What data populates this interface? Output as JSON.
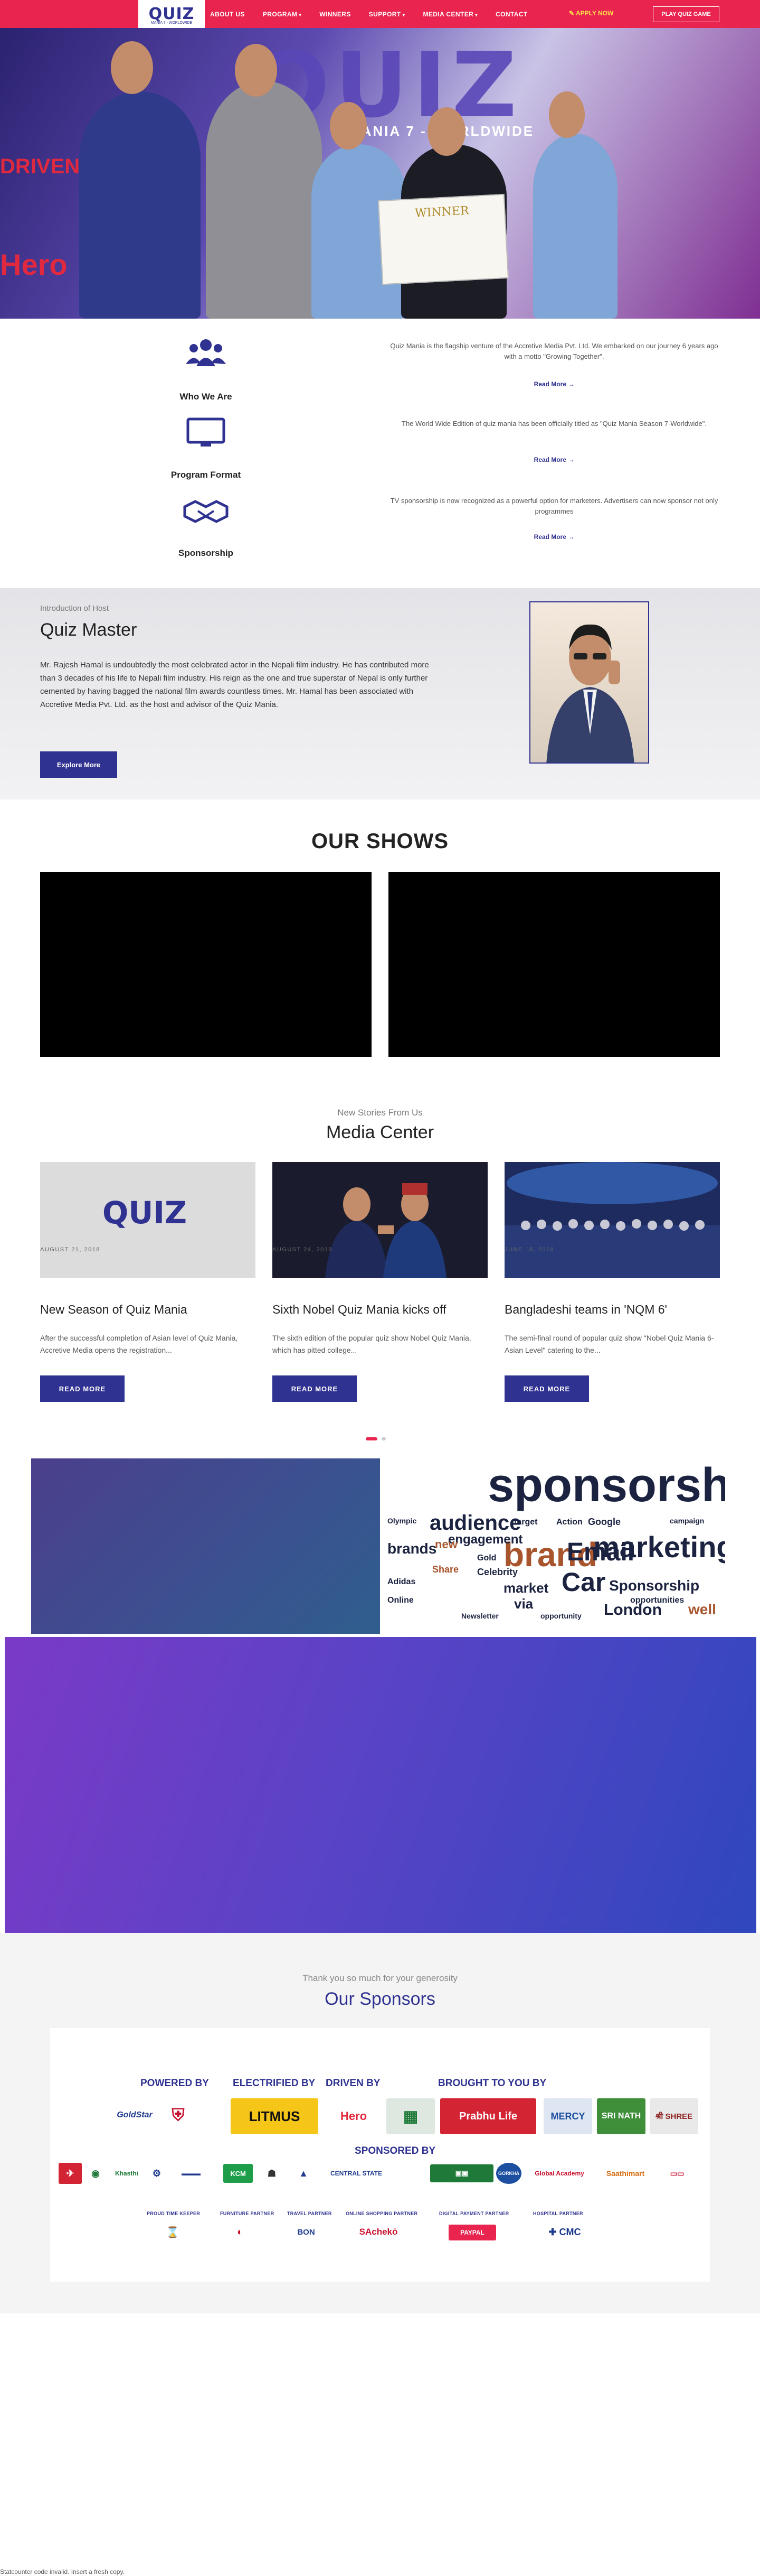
{
  "header": {
    "logo_text": "QUIZ",
    "logo_sub": "MANIA 7 - WORLDWIDE",
    "nav": [
      {
        "label": "ABOUT US",
        "caret": false
      },
      {
        "label": "PROGRAM",
        "caret": true
      },
      {
        "label": "WINNERS",
        "caret": false
      },
      {
        "label": "SUPPORT",
        "caret": true
      },
      {
        "label": "MEDIA CENTER",
        "caret": true
      },
      {
        "label": "CONTACT",
        "caret": false
      }
    ],
    "apply_label": "APPLY NOW",
    "play_label": "PLAY QUIZ GAME",
    "colors": {
      "bar": "#e8244f",
      "accent": "#2f3290"
    }
  },
  "hero": {
    "banner_text": "QUIZ",
    "banner_sub": "MANIA 7 - WORLDWIDE",
    "left_text_1": "DRIVEN",
    "left_text_2": "Hero",
    "cheque_text": "WINNER"
  },
  "services": [
    {
      "icon": "users-icon",
      "label": "Who We Are",
      "text": "Quiz Mania is the flagship venture of the Accretive Media Pvt. Ltd. We embarked on our journey 6 years ago with a motto \"Growing Together\".",
      "more": "Read More →"
    },
    {
      "icon": "monitor-icon",
      "label": "Program Format",
      "text": "The World Wide Edition of quiz mania has been officially titled as \"Quiz Mania Season 7-Worldwide\".",
      "more": "Read More →"
    },
    {
      "icon": "handshake-icon",
      "label": "Sponsorship",
      "text": "TV sponsorship is now recognized as a powerful option for marketers. Advertisers can now sponsor not only programmes",
      "more": "Read More →"
    }
  ],
  "quiz_master": {
    "pre": "Introduction of Host",
    "title": "Quiz Master",
    "desc": "Mr. Rajesh Hamal is undoubtedly the most celebrated actor in the Nepali film industry. He has contributed more than 3 decades of his life to Nepali film industry. His reign as the one and true superstar of Nepal is only further cemented by having bagged the national film awards countless times. Mr. Hamal has been associated with Accretive Media Pvt. Ltd. as the host and advisor of the Quiz Mania.",
    "button": "Explore More"
  },
  "shows": {
    "title": "OUR SHOWS"
  },
  "media": {
    "pre": "New Stories From Us",
    "title": "Media Center",
    "cards": [
      {
        "date": "AUGUST 21, 2018",
        "title": "New Season of Quiz Mania",
        "desc": "After the successful completion of Asian level of Quiz Mania, Accretive Media opens the registration...",
        "button": "READ MORE"
      },
      {
        "date": "AUGUST 24, 2018",
        "title": "Sixth Nobel Quiz Mania kicks off",
        "desc": "The sixth edition of the popular quiz show Nobel Quiz Mania, which has pitted college...",
        "button": "READ MORE"
      },
      {
        "date": "JUNE 18, 2018",
        "title": "Bangladeshi teams in 'NQM 6'",
        "desc": "The semi-final round of popular quiz show \"Nobel Quiz Mania 6-Asian Level\" catering to the...",
        "button": "READ MORE"
      }
    ]
  },
  "sponsorship_cloud": {
    "words": [
      "sponsorship",
      "audience",
      "brand",
      "Email",
      "marketing",
      "Car",
      "Sponsorship",
      "engagement",
      "London",
      "brands",
      "market",
      "new",
      "via",
      "opportunity",
      "Google",
      "target",
      "Share",
      "Celebrity",
      "opportunities",
      "well",
      "campaign",
      "Adidas",
      "Olympic",
      "Gold",
      "Action",
      "Online",
      "Newsletter"
    ]
  },
  "sponsors": {
    "pre": "Thank you so much for your generosity",
    "title": "Our Sponsors",
    "headings": {
      "powered": "POWERED BY",
      "electrified": "ELECTRIFIED BY",
      "driven": "DRIVEN BY",
      "brought": "BROUGHT TO YOU BY",
      "sponsored": "SPONSORED BY"
    },
    "partner_labels": [
      "PROUD TIME KEEPER",
      "FURNITURE PARTNER",
      "TRAVEL PARTNER",
      "ONLINE SHOPPING PARTNER",
      "DIGITAL PAYMENT PARTNER",
      "HOSPITAL PARTNER"
    ],
    "top_logos": [
      {
        "name": "goldstar-logo",
        "text": "GoldStar",
        "color": "#1f3b8f",
        "bg": "#ffffff"
      },
      {
        "name": "nepal-army-logo",
        "text": "⛨",
        "color": "#c8102e",
        "bg": "#ffffff"
      },
      {
        "name": "litmus-logo",
        "text": "LITMUS",
        "color": "#111111",
        "bg": "#f5c518"
      },
      {
        "name": "hero-logo",
        "text": "Hero",
        "color": "#e0293e",
        "bg": "#ffffff"
      },
      {
        "name": "bank-logo",
        "text": "▦",
        "color": "#1f7a3a",
        "bg": "#dfe8e0"
      },
      {
        "name": "prabhu-life-logo",
        "text": "Prabhu Life",
        "color": "#ffffff",
        "bg": "#d32434"
      },
      {
        "name": "mercy-logo",
        "text": "MERCY",
        "color": "#1c4fa0",
        "bg": "#dfe6f3"
      },
      {
        "name": "sri-nath-logo",
        "text": "SRI NATH",
        "color": "#ffffff",
        "bg": "#3e8e3a"
      },
      {
        "name": "shree-logo",
        "text": "श्री SHREE",
        "color": "#8c1c1c",
        "bg": "#e9e9e9"
      }
    ],
    "sponsored_logos": [
      {
        "name": "airlines-logo",
        "text": "✈",
        "color": "#ffffff",
        "bg": "#d32434"
      },
      {
        "name": "logo-2",
        "text": "◉",
        "color": "#1f7a3a",
        "bg": "#ffffff"
      },
      {
        "name": "logo-3",
        "text": "Khasthi",
        "color": "#1f7a3a",
        "bg": "#ffffff"
      },
      {
        "name": "logo-4",
        "text": "⚙",
        "color": "#1f3b8f",
        "bg": "#ffffff"
      },
      {
        "name": "logo-5",
        "text": "▬▬▬",
        "color": "#1f3b8f",
        "bg": "#ffffff"
      },
      {
        "name": "logo-6",
        "text": "KCM",
        "color": "#ffffff",
        "bg": "#1f9e49"
      },
      {
        "name": "logo-7",
        "text": "☗",
        "color": "#333333",
        "bg": "#ffffff"
      },
      {
        "name": "logo-8",
        "text": "▲",
        "color": "#1f3b8f",
        "bg": "#ffffff"
      },
      {
        "name": "central-state-logo",
        "text": "CENTRAL STATE",
        "color": "#1f3b8f",
        "bg": "#ffffff"
      },
      {
        "name": "logo-10",
        "text": "▣▣",
        "color": "#ffffff",
        "bg": "#1f7a3a"
      },
      {
        "name": "gorkha-logo",
        "text": "GORKHA",
        "color": "#ffffff",
        "bg": "#1c4fa0"
      },
      {
        "name": "global-academy-logo",
        "text": "Global Academy",
        "color": "#c8102e",
        "bg": "#ffffff"
      },
      {
        "name": "saathimart-logo",
        "text": "Saathimart",
        "color": "#d66a0f",
        "bg": "#ffffff"
      },
      {
        "name": "logo-14",
        "text": "▭▭",
        "color": "#c8102e",
        "bg": "#ffffff"
      }
    ],
    "partner_logos": [
      {
        "name": "timekeeper-logo",
        "text": "⌛",
        "color": "#111111",
        "bg": "#ffffff"
      },
      {
        "name": "furniture-logo",
        "text": "◐",
        "color": "#c8102e",
        "bg": "#ffffff"
      },
      {
        "name": "travel-logo",
        "text": "BON",
        "color": "#1f3b8f",
        "bg": "#ffffff"
      },
      {
        "name": "sastodeal-logo",
        "text": "SAchekō",
        "color": "#c8102e",
        "bg": "#ffffff"
      },
      {
        "name": "esewa-logo",
        "text": "PAYPAL",
        "color": "#ffffff",
        "bg": "#e8244f"
      },
      {
        "name": "cmc-logo",
        "text": "✚ CMC",
        "color": "#1f3b8f",
        "bg": "#ffffff"
      }
    ]
  },
  "footer_note": "Statcounter code invalid. Insert a fresh copy."
}
